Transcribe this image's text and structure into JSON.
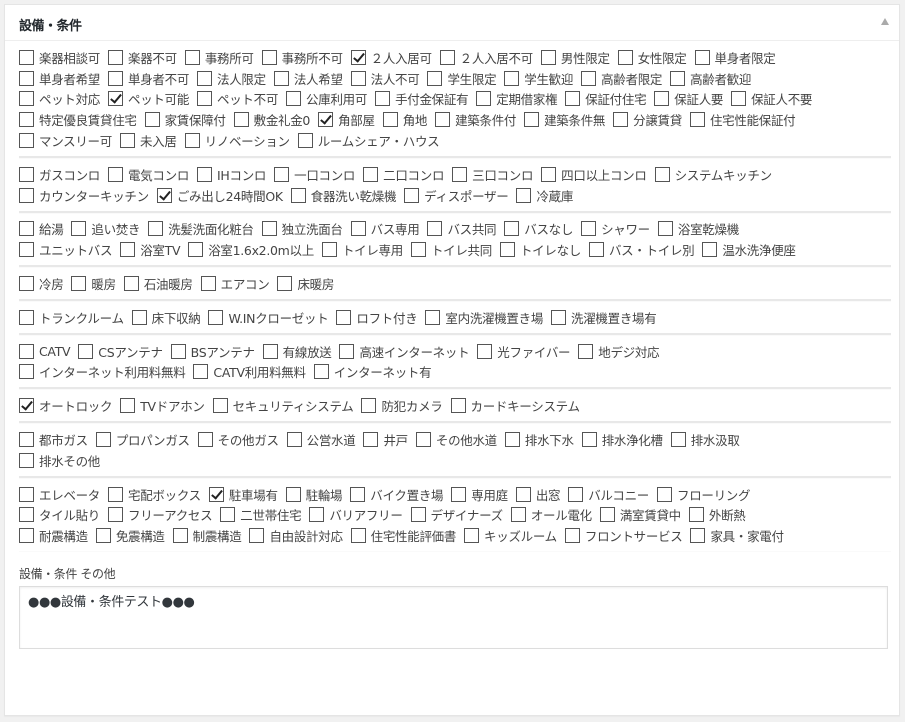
{
  "panel": {
    "title": "設備・条件",
    "toggle_icon": "triangle-up",
    "groups": [
      {
        "items": [
          {
            "label": "楽器相談可",
            "checked": false
          },
          {
            "label": "楽器不可",
            "checked": false
          },
          {
            "label": "事務所可",
            "checked": false
          },
          {
            "label": "事務所不可",
            "checked": false
          },
          {
            "label": "２人入居可",
            "checked": true
          },
          {
            "label": "２人入居不可",
            "checked": false
          },
          {
            "label": "男性限定",
            "checked": false
          },
          {
            "label": "女性限定",
            "checked": false
          },
          {
            "label": "単身者限定",
            "checked": false
          },
          {
            "label": "単身者希望",
            "checked": false
          },
          {
            "label": "単身者不可",
            "checked": false
          },
          {
            "label": "法人限定",
            "checked": false
          },
          {
            "label": "法人希望",
            "checked": false
          },
          {
            "label": "法人不可",
            "checked": false
          },
          {
            "label": "学生限定",
            "checked": false
          },
          {
            "label": "学生歓迎",
            "checked": false
          },
          {
            "label": "高齢者限定",
            "checked": false
          },
          {
            "label": "高齢者歓迎",
            "checked": false
          },
          {
            "label": "ペット対応",
            "checked": false
          },
          {
            "label": "ペット可能",
            "checked": true
          },
          {
            "label": "ペット不可",
            "checked": false
          },
          {
            "label": "公庫利用可",
            "checked": false
          },
          {
            "label": "手付金保証有",
            "checked": false
          },
          {
            "label": "定期借家権",
            "checked": false
          },
          {
            "label": "保証付住宅",
            "checked": false
          },
          {
            "label": "保証人要",
            "checked": false
          },
          {
            "label": "保証人不要",
            "checked": false
          },
          {
            "label": "特定優良賃貸住宅",
            "checked": false
          },
          {
            "label": "家賃保障付",
            "checked": false
          },
          {
            "label": "敷金礼金0",
            "checked": false
          },
          {
            "label": "角部屋",
            "checked": true
          },
          {
            "label": "角地",
            "checked": false
          },
          {
            "label": "建築条件付",
            "checked": false
          },
          {
            "label": "建築条件無",
            "checked": false
          },
          {
            "label": "分譲賃貸",
            "checked": false
          },
          {
            "label": "住宅性能保証付",
            "checked": false
          },
          {
            "label": "マンスリー可",
            "checked": false
          },
          {
            "label": "未入居",
            "checked": false
          },
          {
            "label": "リノベーション",
            "checked": false
          },
          {
            "label": "ルームシェア・ハウス",
            "checked": false
          }
        ]
      },
      {
        "items": [
          {
            "label": "ガスコンロ",
            "checked": false
          },
          {
            "label": "電気コンロ",
            "checked": false
          },
          {
            "label": "IHコンロ",
            "checked": false
          },
          {
            "label": "一口コンロ",
            "checked": false
          },
          {
            "label": "二口コンロ",
            "checked": false
          },
          {
            "label": "三口コンロ",
            "checked": false
          },
          {
            "label": "四口以上コンロ",
            "checked": false
          },
          {
            "label": "システムキッチン",
            "checked": false
          },
          {
            "label": "カウンターキッチン",
            "checked": false
          },
          {
            "label": "ごみ出し24時間OK",
            "checked": true
          },
          {
            "label": "食器洗い乾燥機",
            "checked": false
          },
          {
            "label": "ディスポーザー",
            "checked": false
          },
          {
            "label": "冷蔵庫",
            "checked": false
          }
        ]
      },
      {
        "items": [
          {
            "label": "給湯",
            "checked": false
          },
          {
            "label": "追い焚き",
            "checked": false
          },
          {
            "label": "洗髪洗面化粧台",
            "checked": false
          },
          {
            "label": "独立洗面台",
            "checked": false
          },
          {
            "label": "バス専用",
            "checked": false
          },
          {
            "label": "バス共同",
            "checked": false
          },
          {
            "label": "バスなし",
            "checked": false
          },
          {
            "label": "シャワー",
            "checked": false
          },
          {
            "label": "浴室乾燥機",
            "checked": false
          },
          {
            "label": "ユニットバス",
            "checked": false
          },
          {
            "label": "浴室TV",
            "checked": false
          },
          {
            "label": "浴室1.6x2.0m以上",
            "checked": false
          },
          {
            "label": "トイレ専用",
            "checked": false
          },
          {
            "label": "トイレ共同",
            "checked": false
          },
          {
            "label": "トイレなし",
            "checked": false
          },
          {
            "label": "バス・トイレ別",
            "checked": false
          },
          {
            "label": "温水洗浄便座",
            "checked": false
          }
        ]
      },
      {
        "items": [
          {
            "label": "冷房",
            "checked": false
          },
          {
            "label": "暖房",
            "checked": false
          },
          {
            "label": "石油暖房",
            "checked": false
          },
          {
            "label": "エアコン",
            "checked": false
          },
          {
            "label": "床暖房",
            "checked": false
          }
        ]
      },
      {
        "items": [
          {
            "label": "トランクルーム",
            "checked": false
          },
          {
            "label": "床下収納",
            "checked": false
          },
          {
            "label": "W.INクローゼット",
            "checked": false
          },
          {
            "label": "ロフト付き",
            "checked": false
          },
          {
            "label": "室内洗濯機置き場",
            "checked": false
          },
          {
            "label": "洗濯機置き場有",
            "checked": false
          }
        ]
      },
      {
        "items": [
          {
            "label": "CATV",
            "checked": false
          },
          {
            "label": "CSアンテナ",
            "checked": false
          },
          {
            "label": "BSアンテナ",
            "checked": false
          },
          {
            "label": "有線放送",
            "checked": false
          },
          {
            "label": "高速インターネット",
            "checked": false
          },
          {
            "label": "光ファイバー",
            "checked": false
          },
          {
            "label": "地デジ対応",
            "checked": false
          },
          {
            "label": "インターネット利用料無料",
            "checked": false
          },
          {
            "label": "CATV利用料無料",
            "checked": false
          },
          {
            "label": "インターネット有",
            "checked": false
          }
        ]
      },
      {
        "items": [
          {
            "label": "オートロック",
            "checked": true
          },
          {
            "label": "TVドアホン",
            "checked": false
          },
          {
            "label": "セキュリティシステム",
            "checked": false
          },
          {
            "label": "防犯カメラ",
            "checked": false
          },
          {
            "label": "カードキーシステム",
            "checked": false
          }
        ]
      },
      {
        "items": [
          {
            "label": "都市ガス",
            "checked": false
          },
          {
            "label": "プロパンガス",
            "checked": false
          },
          {
            "label": "その他ガス",
            "checked": false
          },
          {
            "label": "公営水道",
            "checked": false
          },
          {
            "label": "井戸",
            "checked": false
          },
          {
            "label": "その他水道",
            "checked": false
          },
          {
            "label": "排水下水",
            "checked": false
          },
          {
            "label": "排水浄化槽",
            "checked": false
          },
          {
            "label": "排水汲取",
            "checked": false
          },
          {
            "label": "排水その他",
            "checked": false
          }
        ]
      },
      {
        "items": [
          {
            "label": "エレベータ",
            "checked": false
          },
          {
            "label": "宅配ボックス",
            "checked": false
          },
          {
            "label": "駐車場有",
            "checked": true
          },
          {
            "label": "駐輪場",
            "checked": false
          },
          {
            "label": "バイク置き場",
            "checked": false
          },
          {
            "label": "専用庭",
            "checked": false
          },
          {
            "label": "出窓",
            "checked": false
          },
          {
            "label": "バルコニー",
            "checked": false
          },
          {
            "label": "フローリング",
            "checked": false
          },
          {
            "label": "タイル貼り",
            "checked": false
          },
          {
            "label": "フリーアクセス",
            "checked": false
          },
          {
            "label": "二世帯住宅",
            "checked": false
          },
          {
            "label": "バリアフリー",
            "checked": false
          },
          {
            "label": "デザイナーズ",
            "checked": false
          },
          {
            "label": "オール電化",
            "checked": false
          },
          {
            "label": "満室賃貸中",
            "checked": false
          },
          {
            "label": "外断熱",
            "checked": false
          },
          {
            "label": "耐震構造",
            "checked": false
          },
          {
            "label": "免震構造",
            "checked": false
          },
          {
            "label": "制震構造",
            "checked": false
          },
          {
            "label": "自由設計対応",
            "checked": false
          },
          {
            "label": "住宅性能評価書",
            "checked": false
          },
          {
            "label": "キッズルーム",
            "checked": false
          },
          {
            "label": "フロントサービス",
            "checked": false
          },
          {
            "label": "家具・家電付",
            "checked": false
          }
        ]
      }
    ],
    "other": {
      "label": "設備・条件 その他",
      "value": "●●●設備・条件テスト●●●"
    }
  }
}
